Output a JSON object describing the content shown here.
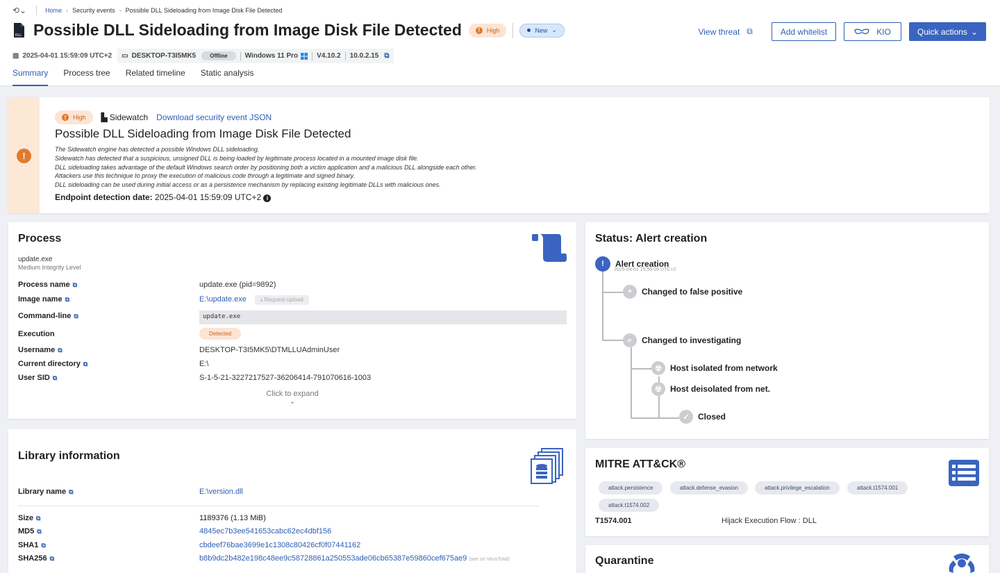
{
  "breadcrumb": {
    "home": "Home",
    "section": "Security events",
    "current": "Possible DLL Sideloading from Image Disk File Detected"
  },
  "page_title": "Possible DLL Sideloading from Image Disk File Detected",
  "severity": "High",
  "status_badge": "New",
  "actions": {
    "view_threat": "View threat",
    "add_whitelist": "Add whitelist",
    "kio": "KIO",
    "quick_actions": "Quick actions"
  },
  "meta": {
    "timestamp": "2025-04-01 15:59:09 UTC+2",
    "host": "DESKTOP-T3I5MK5",
    "host_status": "Offline",
    "os": "Windows 11 Pro",
    "agent_version": "V4.10.2",
    "ip": "10.0.2.15"
  },
  "tabs": [
    "Summary",
    "Process tree",
    "Related timeline",
    "Static analysis"
  ],
  "banner": {
    "severity": "High",
    "engine": "Sidewatch",
    "download": "Download security event JSON",
    "title": "Possible DLL Sideloading from Image Disk File Detected",
    "desc": [
      "The Sidewatch engine has detected a possible Windows DLL sideloading.",
      "Sidewatch has detected that a suspicious, unsigned DLL is being loaded by legitimate process located in a mounted image disk file.",
      "DLL sideloading takes advantage of the default Windows search order by positioning both a victim application and a malicious DLL alongside each other.",
      "Attackers use this technique to proxy the execution of malicious code through a legitimate and signed binary.",
      "DLL sideloading can be used during initial access or as a persistence mechanism by replacing existing legitimate DLLs with malicious ones."
    ],
    "detection_label": "Endpoint detection date:",
    "detection_date": "2025-04-01 15:59:09 UTC+2"
  },
  "process": {
    "title": "Process",
    "name": "update.exe",
    "integrity": "Medium Integrity Level",
    "labels": {
      "process_name": "Process name",
      "image_name": "Image name",
      "command_line": "Command-line",
      "execution": "Execution",
      "username": "Username",
      "current_directory": "Current directory",
      "user_sid": "User SID"
    },
    "process_name": "update.exe (pid=9892)",
    "image_name": "E:\\update.exe",
    "request_upload": "Request upload",
    "command_line": "update.exe",
    "execution": "Detected",
    "username": "DESKTOP-T3I5MK5\\DTMLLUAdminUser",
    "current_directory": "E:\\",
    "user_sid": "S-1-5-21-3227217527-36206414-791070616-1003",
    "expand": "Click to expand"
  },
  "library": {
    "title": "Library information",
    "labels": {
      "library_name": "Library name",
      "size": "Size",
      "md5": "MD5",
      "sha1": "SHA1",
      "sha256": "SHA256"
    },
    "library_name": "E:\\version.dll",
    "size": "1189376 (1.13 MiB)",
    "md5": "4845ec7b3ee541653cabc62ec4dbf156",
    "sha1": "cbdeef76bae3699e1c1308c80426cf0f07441162",
    "sha256": "b8b9dc2b482e198c48ee9c58728861a250553ade06cb65387e59860cef675ae9",
    "virustotal": "(see on VirusTotal)"
  },
  "status": {
    "title": "Status: Alert creation",
    "steps": {
      "alert": "Alert creation",
      "alert_time": "2025-04-01 15:59:09 UTC+2",
      "false_positive": "Changed to false positive",
      "investigating": "Changed to investigating",
      "isolated": "Host isolated from network",
      "deisolated": "Host deisolated from net.",
      "closed": "Closed"
    }
  },
  "mitre": {
    "title": "MITRE ATT&CK®",
    "tags": [
      "attack.persistence",
      "attack.defense_evasion",
      "attack.privilege_escalation",
      "attack.t1574.001",
      "attack.t1574.002"
    ],
    "technique_id": "T1574.001",
    "technique_name": "Hijack Execution Flow : DLL"
  },
  "quarantine": {
    "title": "Quarantine"
  },
  "colors": {
    "accent": "#3a64c0",
    "high": "#e07a2e",
    "high_bg": "#fde4d4"
  }
}
